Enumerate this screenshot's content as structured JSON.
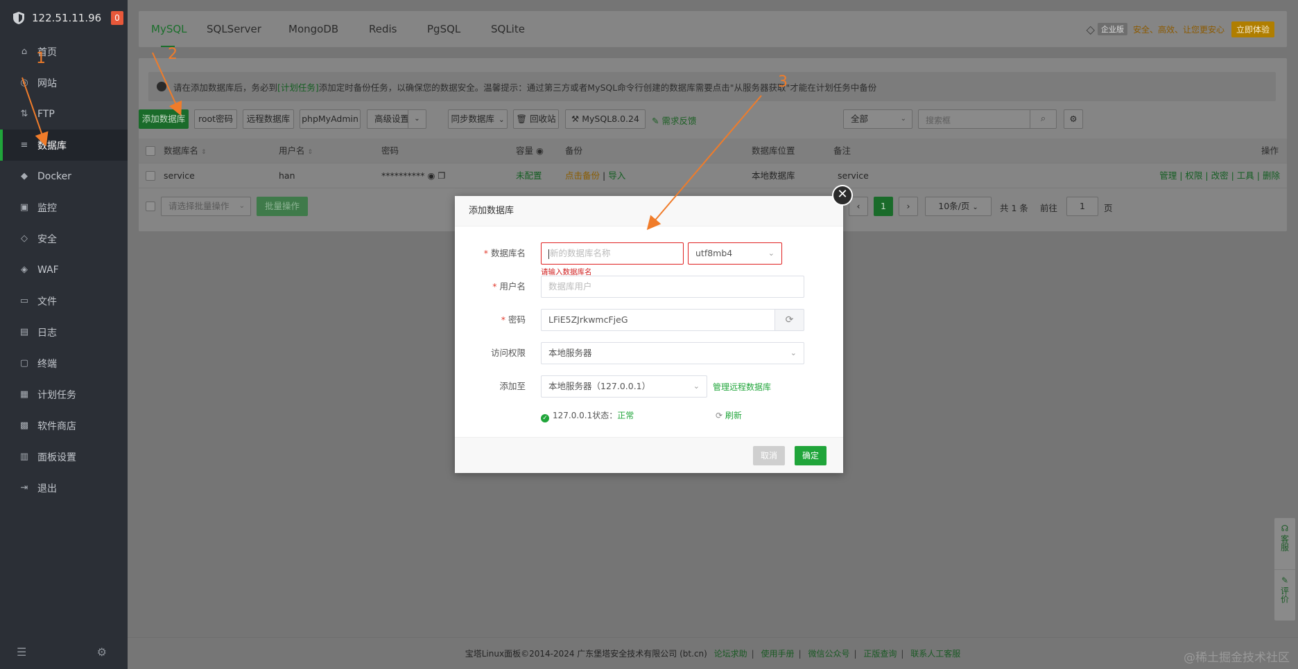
{
  "sidebar": {
    "ip": "122.51.11.96",
    "badge": "0",
    "items": [
      {
        "label": "首页",
        "icon": "home-icon",
        "glyph": "⌂"
      },
      {
        "label": "网站",
        "icon": "globe-icon",
        "glyph": "◎"
      },
      {
        "label": "FTP",
        "icon": "ftp-icon",
        "glyph": "⇅"
      },
      {
        "label": "数据库",
        "icon": "database-icon",
        "glyph": "≡"
      },
      {
        "label": "Docker",
        "icon": "docker-icon",
        "glyph": "◆"
      },
      {
        "label": "监控",
        "icon": "monitor-icon",
        "glyph": "▣"
      },
      {
        "label": "安全",
        "icon": "shield-icon",
        "glyph": "◇"
      },
      {
        "label": "WAF",
        "icon": "waf-icon",
        "glyph": "◈"
      },
      {
        "label": "文件",
        "icon": "folder-icon",
        "glyph": "▭"
      },
      {
        "label": "日志",
        "icon": "log-icon",
        "glyph": "▤"
      },
      {
        "label": "终端",
        "icon": "terminal-icon",
        "glyph": "▢"
      },
      {
        "label": "计划任务",
        "icon": "calendar-icon",
        "glyph": "▦"
      },
      {
        "label": "软件商店",
        "icon": "store-icon",
        "glyph": "▩"
      },
      {
        "label": "面板设置",
        "icon": "settings-icon",
        "glyph": "▥"
      },
      {
        "label": "退出",
        "icon": "logout-icon",
        "glyph": "⇥"
      }
    ],
    "active_index": 3
  },
  "tabs": [
    "MySQL",
    "SQLServer",
    "MongoDB",
    "Redis",
    "PgSQL",
    "SQLite"
  ],
  "promo": {
    "badge": "企业版",
    "slogan": "安全、高效、让您更安心",
    "button": "立即体验"
  },
  "notice": {
    "pre": "请在添加数据库后，务必到",
    "link": "[计划任务]",
    "post": "添加定时备份任务，以确保您的数据安全。温馨提示：通过第三方或者MySQL命令行创建的数据库需要点击\"从服务器获取\"才能在计划任务中备份"
  },
  "toolbar": {
    "add_db": "添加数据库",
    "root_pwd": "root密码",
    "remote_db": "远程数据库",
    "phpmyadmin": "phpMyAdmin",
    "advanced": "高级设置",
    "sync_db": "同步数据库",
    "recycle": "回收站",
    "version": "MySQL8.0.24",
    "feedback": "需求反馈",
    "filter": "全部",
    "search_placeholder": "搜索框"
  },
  "table": {
    "headers": {
      "name": "数据库名",
      "user": "用户名",
      "password": "密码",
      "capacity": "容量",
      "backup": "备份",
      "location": "数据库位置",
      "remark": "备注",
      "ops": "操作"
    },
    "rows": [
      {
        "name": "service",
        "user": "han",
        "password": "**********",
        "capacity": "未配置",
        "backup_action": "点击备份",
        "import": "导入",
        "location": "本地数据库",
        "remark": "service"
      }
    ],
    "row_ops": [
      "管理",
      "权限",
      "改密",
      "工具",
      "删除"
    ],
    "batch_placeholder": "请选择批量操作",
    "batch_button": "批量操作"
  },
  "pager": {
    "current": "1",
    "per_page": "10条/页",
    "total": "共 1 条",
    "goto_label": "前往",
    "goto_value": "1",
    "page_suffix": "页"
  },
  "dialog": {
    "title": "添加数据库",
    "db_name_label": "数据库名",
    "db_name_placeholder": "新的数据库名称",
    "charset": "utf8mb4",
    "db_name_error": "请输入数据库名",
    "user_label": "用户名",
    "user_placeholder": "数据库用户",
    "pwd_label": "密码",
    "pwd_value": "LFiE5ZJrkwmcFjeG",
    "access_label": "访问权限",
    "access_value": "本地服务器",
    "add_to_label": "添加至",
    "add_to_value": "本地服务器（127.0.0.1）",
    "manage_remote": "管理远程数据库",
    "status_prefix": "127.0.0.1状态：",
    "status_value": "正常",
    "refresh": "刷新",
    "cancel": "取消",
    "confirm": "确定"
  },
  "annotations": [
    "1",
    "2",
    "3"
  ],
  "side_float": {
    "service": "客服",
    "review": "评价"
  },
  "footer": {
    "copyright": "宝塔Linux面板©2014-2024 广东堡塔安全技术有限公司 (bt.cn)",
    "links": [
      "论坛求助",
      "使用手册",
      "微信公众号",
      "正版查询",
      "联系人工客服"
    ]
  },
  "watermark": "@稀土掘金技术社区",
  "colors": {
    "brand_green": "#20a53a",
    "error_red": "#e02020",
    "annotation_orange": "#f07c2a",
    "sidebar_bg": "#2b2f36"
  }
}
